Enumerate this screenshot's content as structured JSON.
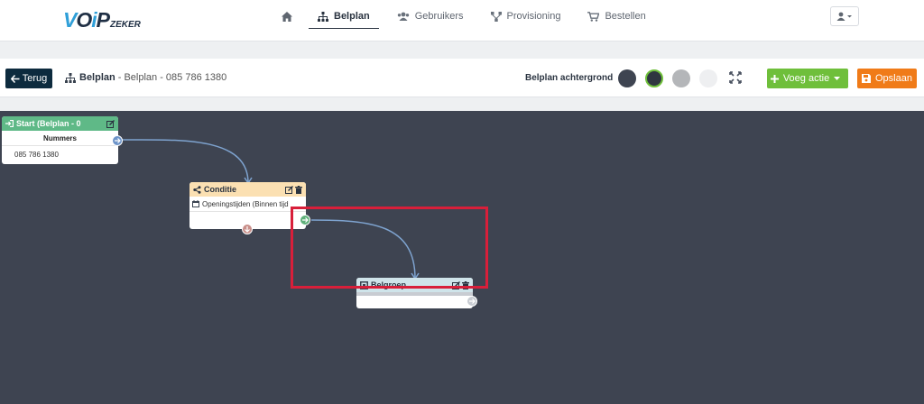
{
  "nav": {
    "logo": {
      "main": "VOIP",
      "sub": "ZEKER"
    },
    "items": [
      {
        "label": "",
        "icon": "home-icon"
      },
      {
        "label": "Belplan",
        "icon": "sitemap-icon",
        "active": true
      },
      {
        "label": "Gebruikers",
        "icon": "users-icon"
      },
      {
        "label": "Provisioning",
        "icon": "network-icon"
      },
      {
        "label": "Bestellen",
        "icon": "cart-icon"
      }
    ],
    "user_icon": "user-icon"
  },
  "toolbar": {
    "back_label": "Terug",
    "breadcrumb_title": "Belplan",
    "breadcrumb_rest": "- Belplan - 085 786 1380",
    "background_label": "Belplan achtergrond",
    "background_colors": [
      "#3e4451",
      "#2f3640",
      "#b4b6b9",
      "#eeeff1"
    ],
    "add_action_label": "Voeg actie",
    "save_label": "Opslaan",
    "colors": {
      "back": "#0d2b3e",
      "add_action": "#6fbf3b",
      "save": "#f07b18"
    }
  },
  "canvas": {
    "background": "#3e4451",
    "nodes": {
      "start": {
        "title": "Start (Belplan - 0",
        "row1": "Nummers",
        "row2": "085 786 1380"
      },
      "condition": {
        "title": "Conditie",
        "row1": "Openingstijden (Binnen tijd"
      },
      "group": {
        "title": "Belgroep"
      }
    }
  }
}
